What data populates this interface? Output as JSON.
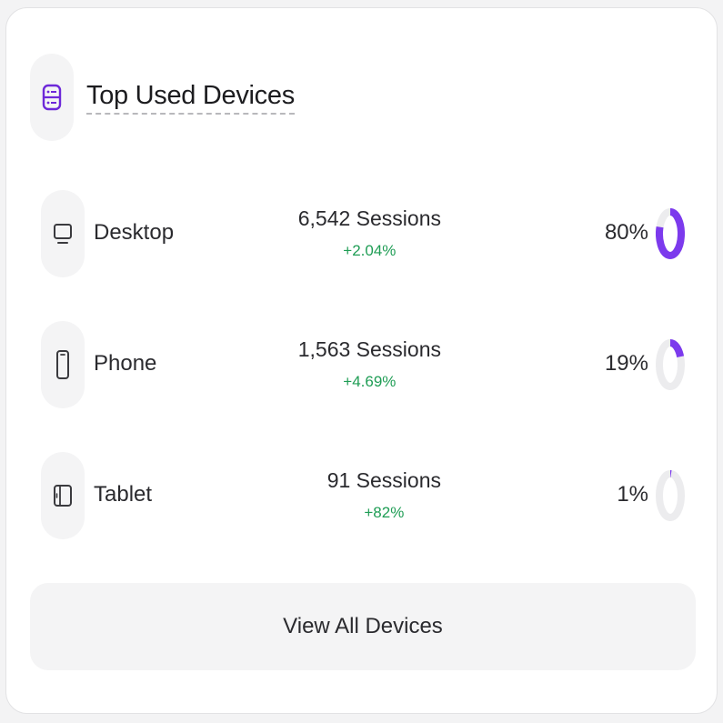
{
  "header": {
    "title": "Top Used Devices",
    "icon": "server-stack-icon",
    "accent_color": "#6d28d9"
  },
  "devices": [
    {
      "name": "Desktop",
      "icon": "monitor-icon",
      "sessions": "6,542 Sessions",
      "change": "+2.04%",
      "percent_label": "80%",
      "percent": 80
    },
    {
      "name": "Phone",
      "icon": "smartphone-icon",
      "sessions": "1,563 Sessions",
      "change": "+4.69%",
      "percent_label": "19%",
      "percent": 19
    },
    {
      "name": "Tablet",
      "icon": "tablet-icon",
      "sessions": "91 Sessions",
      "change": "+82%",
      "percent_label": "1%",
      "percent": 1
    }
  ],
  "footer": {
    "button_label": "View All Devices"
  },
  "colors": {
    "positive": "#1f9d55",
    "ring_fill": "#7c3aed",
    "ring_track": "#ececee"
  }
}
